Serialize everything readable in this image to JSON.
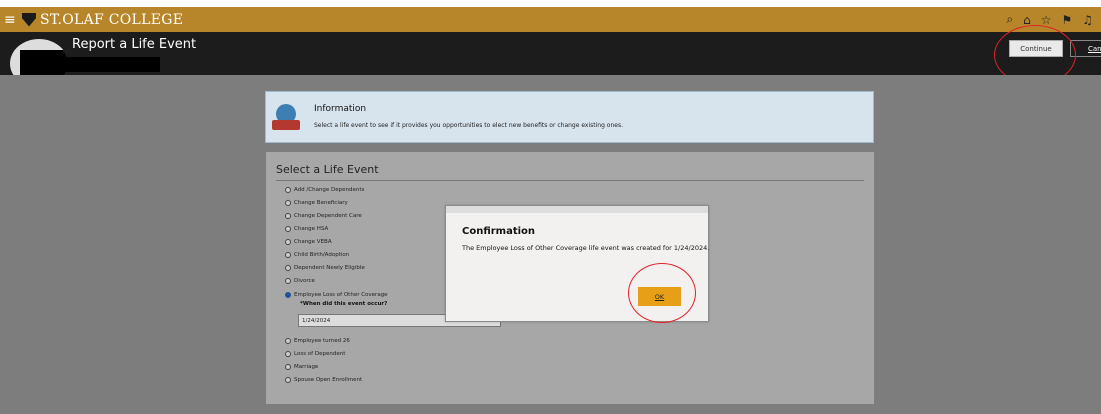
{
  "brand": {
    "name": "ST.OLAF COLLEGE"
  },
  "header": {
    "page_title": "Report a Life Event",
    "continue_label": "Continue",
    "cancel_label": "Canc"
  },
  "info": {
    "title": "Information",
    "text": "Select a life event to see if it provides you opportunities to elect new benefits or change existing ones."
  },
  "panel": {
    "title": "Select a Life Event",
    "options": [
      {
        "label": "Add /Change Dependents",
        "selected": false
      },
      {
        "label": "Change Beneficiary",
        "selected": false
      },
      {
        "label": "Change Dependent Care",
        "selected": false
      },
      {
        "label": "Change HSA",
        "selected": false
      },
      {
        "label": "Change VEBA",
        "selected": false
      },
      {
        "label": "Child Birth/Adoption",
        "selected": false
      },
      {
        "label": "Dependent Newly Eligible",
        "selected": false
      },
      {
        "label": "Divorce",
        "selected": false
      },
      {
        "label": "Employee Loss of Other Coverage",
        "selected": true
      },
      {
        "label": "Employee turned 26",
        "selected": false
      },
      {
        "label": "Loss of Dependent",
        "selected": false
      },
      {
        "label": "Marriage",
        "selected": false
      },
      {
        "label": "Spouse Open Enrollment",
        "selected": false
      }
    ],
    "date_question": "*When did this event occur?",
    "date_value": "1/24/2024"
  },
  "dialog": {
    "title": "Confirmation",
    "message": "The Employee Loss of Other Coverage life event was created for 1/24/2024.",
    "ok_label": "OK"
  },
  "colors": {
    "brand_gold": "#b8862a",
    "header_dark": "#1c1c1c",
    "ok_orange": "#e89f18",
    "annotation_red": "#e0222a"
  },
  "icons": [
    "hamburger-icon",
    "shield-logo-icon",
    "search-icon",
    "home-icon",
    "star-icon",
    "flag-icon",
    "bell-icon",
    "globe-book-icon"
  ]
}
